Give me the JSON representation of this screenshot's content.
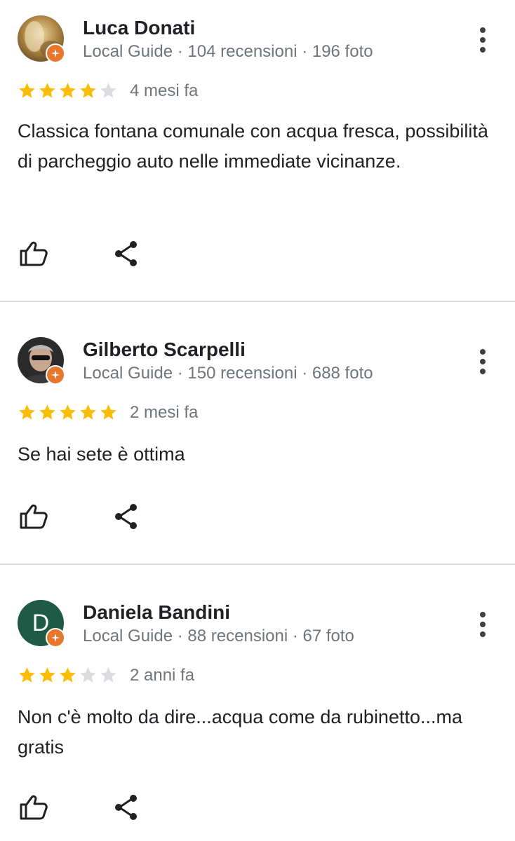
{
  "reviews": [
    {
      "name": "Luca Donati",
      "meta": "Local Guide · 104 recensioni · 196 foto",
      "rating": 4,
      "time": "4 mesi fa",
      "text": "Classica fontana comunale con acqua fresca, possibilità di parcheggio auto nelle immediate vicinanze.",
      "avatar": "photo-1"
    },
    {
      "name": "Gilberto Scarpelli",
      "meta": "Local Guide · 150 recensioni · 688 foto",
      "rating": 5,
      "time": "2 mesi fa",
      "text": "Se hai sete è ottima",
      "avatar": "photo-2"
    },
    {
      "name": "Daniela Bandini",
      "meta": "Local Guide · 88 recensioni · 67 foto",
      "rating": 3,
      "time": "2 anni fa",
      "text": "Non c'è molto da dire...acqua come da rubinetto...ma gratis",
      "avatar_letter": "D",
      "avatar_color": "#1e5a45"
    }
  ],
  "colors": {
    "star_filled": "#fbbc04",
    "star_empty": "#dadce0",
    "badge": "#e8772e",
    "divider": "#dadce0"
  },
  "icons": {
    "like": "thumb-up-icon",
    "share": "share-icon",
    "menu": "more-vert-icon",
    "badge": "local-guide-badge-icon"
  }
}
